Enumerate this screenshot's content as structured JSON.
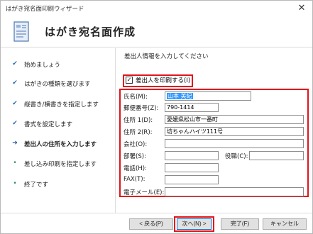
{
  "window": {
    "title": "はがき宛名面印刷ウィザード",
    "close_glyph": "✕"
  },
  "header": {
    "title": "はがき宛名面作成",
    "icon": "postcard-wizard-icon"
  },
  "sidebar": {
    "steps": [
      {
        "label": "始めましょう",
        "mark": "✔"
      },
      {
        "label": "はがきの種類を選びます",
        "mark": "✔"
      },
      {
        "label": "縦書き/横書きを指定します",
        "mark": "✔"
      },
      {
        "label": "書式を設定します",
        "mark": "✔"
      },
      {
        "label": "差出人の住所を入力します",
        "mark": "➔"
      },
      {
        "label": "差し込み印刷を指定します",
        "mark": "•"
      },
      {
        "label": "終了です",
        "mark": "•"
      }
    ]
  },
  "content": {
    "instruction": "差出人情報を入力してください",
    "print_sender": {
      "label": "差出人を印刷する(I)",
      "checked": true,
      "check_glyph": "✓"
    },
    "fields": {
      "name": {
        "label": "氏名(M):",
        "value": "山本 美紀"
      },
      "postal": {
        "label": "郵便番号(Z):",
        "value": "790-1414"
      },
      "address1": {
        "label": "住所 1(D):",
        "value": "愛媛県松山市一番町"
      },
      "address2": {
        "label": "住所 2(R):",
        "value": "坊ちゃんハイツ111号"
      },
      "company": {
        "label": "会社(O):",
        "value": ""
      },
      "department": {
        "label": "部署(S):",
        "value": ""
      },
      "title": {
        "label": "役職(C):",
        "value": ""
      },
      "phone": {
        "label": "電話(H):",
        "value": ""
      },
      "fax": {
        "label": "FAX(T):",
        "value": ""
      },
      "email": {
        "label": "電子メール(E):",
        "value": ""
      }
    }
  },
  "buttons": {
    "back": "< 戻る(P)",
    "next": "次へ(N) >",
    "finish": "完了(F)",
    "cancel": "キャンセル"
  },
  "colors": {
    "highlight": "#e0141b",
    "accent": "#0078d7",
    "selection": "#3399ff"
  }
}
